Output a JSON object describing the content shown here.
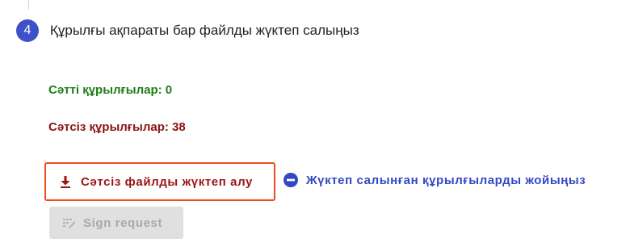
{
  "step": {
    "number": "4",
    "title": "Құрылғы ақпараты бар файлды жүктеп салыңыз"
  },
  "results": {
    "success_label": "Сәтті құрылғылар: 0",
    "fail_label": "Сәтсіз құрылғылар: 38"
  },
  "actions": {
    "download_failed_label": "Сәтсіз файлды жүктеп алу",
    "download_icon": "download-icon",
    "remove_uploaded_label": "Жүктеп салынған құрылғыларды жойыңыз",
    "remove_icon": "minus-circle-icon",
    "sign_request_label": "Sign request",
    "sign_icon": "signature-icon"
  },
  "colors": {
    "accent": "#3f51c8",
    "success": "#1e7d15",
    "failure": "#8a1212",
    "highlight_border": "#ee4b1f"
  }
}
